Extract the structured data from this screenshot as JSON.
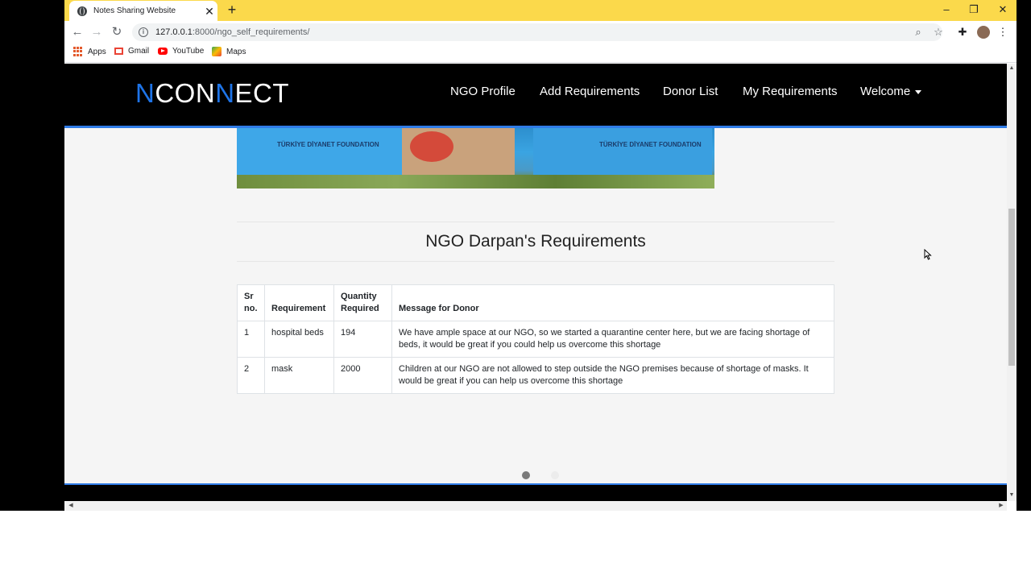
{
  "browser": {
    "tab_title": "Notes Sharing Website",
    "tab_close": "✕",
    "new_tab": "+",
    "url_host": "127.0.0.1",
    "url_path": ":8000/ngo_self_requirements/",
    "bookmarks": [
      "Apps",
      "Gmail",
      "YouTube",
      "Maps"
    ]
  },
  "navbar": {
    "logo_parts": [
      "N",
      "CON",
      "N",
      "ECT"
    ],
    "links": [
      "NGO Profile",
      "Add Requirements",
      "Donor List",
      "My Requirements",
      "Welcome"
    ]
  },
  "banner": {
    "shirt_text_left": "TÜRKİYE DİYANET FOUNDATION",
    "shirt_text_right": "TÜRKİYE DİYANET FOUNDATION"
  },
  "main": {
    "heading": "NGO Darpan's Requirements",
    "table": {
      "headers": [
        "Sr no.",
        "Requirement",
        "Quantity Required",
        "Message for Donor"
      ],
      "rows": [
        [
          "1",
          "hospital beds",
          "194",
          "We have ample space at our NGO, so we started a quarantine center here, but we are facing shortage of beds, it would be great if you could help us overcome this shortage"
        ],
        [
          "2",
          "mask",
          "2000",
          "Children at our NGO are not allowed to step outside the NGO premises because of shortage of masks. It would be great if you can help us overcome this shortage"
        ]
      ]
    },
    "carousel_active_index": 0
  },
  "colors": {
    "tabstrip": "#fbd94b",
    "brand_blue": "#1e74e8",
    "nav_border": "#2f7be6"
  }
}
